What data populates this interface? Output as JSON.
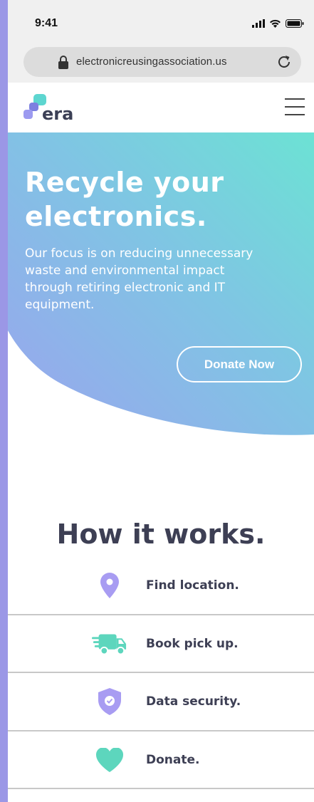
{
  "status_bar": {
    "time": "9:41"
  },
  "browser": {
    "url": "electronicreusingassociation.us"
  },
  "nav": {
    "logo_text": "era"
  },
  "hero": {
    "title_line1": "Recycle your",
    "title_line2": "electronics.",
    "description": "Our focus is on reducing unnecessary waste and environmental impact through retiring electronic and IT equipment.",
    "cta_label": "Donate Now"
  },
  "how_it_works": {
    "title": "How it works.",
    "steps": [
      {
        "label": "Find location.",
        "icon": "location-pin-icon"
      },
      {
        "label": "Book pick up.",
        "icon": "truck-icon"
      },
      {
        "label": "Data security.",
        "icon": "shield-check-icon"
      },
      {
        "label": "Donate.",
        "icon": "heart-icon"
      }
    ]
  },
  "colors": {
    "hero_gradient_start": "#9aa8ee",
    "hero_gradient_end": "#6fe0d6",
    "accent_purple": "#a89cf2",
    "accent_teal": "#5dd6bd",
    "text_dark": "#3d3f54"
  }
}
